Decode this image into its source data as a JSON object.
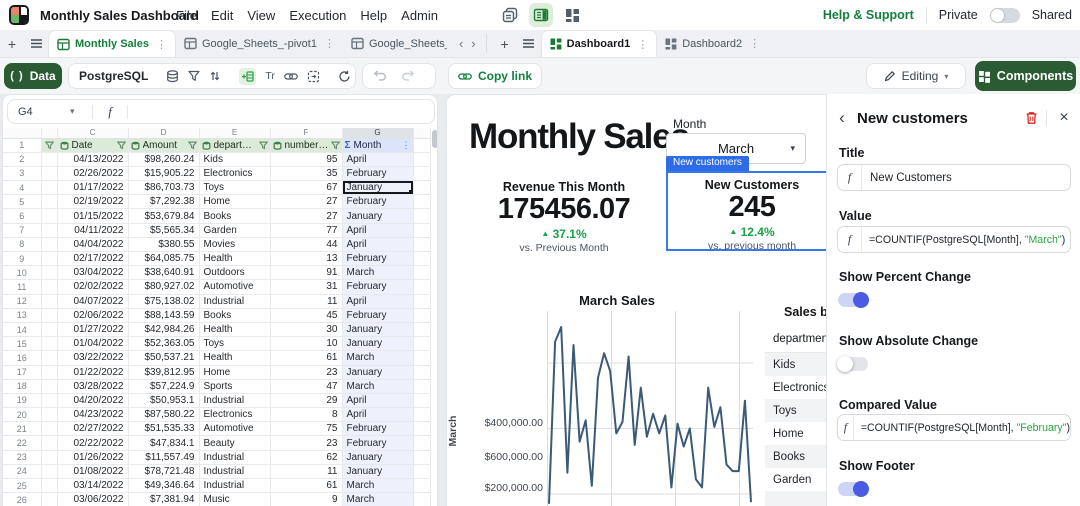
{
  "topbar": {
    "title": "Monthly Sales Dashboard",
    "menus": [
      "File",
      "Edit",
      "View",
      "Execution",
      "Help",
      "Admin"
    ],
    "help_link": "Help & Support",
    "private_label": "Private",
    "shared_label": "Shared"
  },
  "tabs": {
    "sheets": [
      {
        "label": "Monthly Sales",
        "active": true,
        "kebab": true
      },
      {
        "label": "Google_Sheets_-pivot1",
        "active": false,
        "kebab": true
      },
      {
        "label": "Google_Sheets_~",
        "active": false,
        "kebab": false,
        "truncated": true
      }
    ],
    "dashboards": [
      {
        "label": "Dashboard1",
        "active": true,
        "kebab": true
      },
      {
        "label": "Dashboard2",
        "active": false,
        "kebab": true
      }
    ]
  },
  "toolbar": {
    "data_label": "Data",
    "source_label": "PostgreSQL",
    "copy_link_label": "Copy link",
    "editing_label": "Editing",
    "components_label": "Components"
  },
  "formula_bar": {
    "cell_ref": "G4"
  },
  "sheet": {
    "col_letters": [
      "C",
      "D",
      "E",
      "F",
      "G"
    ],
    "headers": [
      "Date",
      "Amount",
      "depart…",
      "number…",
      "Month"
    ],
    "selected": {
      "row": 4,
      "col": "G"
    },
    "rows": [
      [
        "04/13/2022",
        "$98,260.24",
        "Kids",
        "95",
        "April"
      ],
      [
        "02/26/2022",
        "$15,905.22",
        "Electronics",
        "35",
        "February"
      ],
      [
        "01/17/2022",
        "$86,703.73",
        "Toys",
        "67",
        "January"
      ],
      [
        "02/19/2022",
        "$7,292.38",
        "Home",
        "27",
        "February"
      ],
      [
        "01/15/2022",
        "$53,679.84",
        "Books",
        "27",
        "January"
      ],
      [
        "04/11/2022",
        "$5,565.34",
        "Garden",
        "77",
        "April"
      ],
      [
        "04/04/2022",
        "$380.55",
        "Movies",
        "44",
        "April"
      ],
      [
        "02/17/2022",
        "$64,085.75",
        "Health",
        "13",
        "February"
      ],
      [
        "03/04/2022",
        "$38,640.91",
        "Outdoors",
        "91",
        "March"
      ],
      [
        "02/02/2022",
        "$80,927.02",
        "Automotive",
        "31",
        "February"
      ],
      [
        "04/07/2022",
        "$75,138.02",
        "Industrial",
        "11",
        "April"
      ],
      [
        "02/06/2022",
        "$88,143.59",
        "Books",
        "45",
        "February"
      ],
      [
        "01/27/2022",
        "$42,984.26",
        "Health",
        "30",
        "January"
      ],
      [
        "01/04/2022",
        "$52,363.05",
        "Toys",
        "10",
        "January"
      ],
      [
        "03/22/2022",
        "$50,537.21",
        "Health",
        "61",
        "March"
      ],
      [
        "01/22/2022",
        "$39,812.95",
        "Home",
        "23",
        "January"
      ],
      [
        "03/28/2022",
        "$57,224.9",
        "Sports",
        "47",
        "March"
      ],
      [
        "04/20/2022",
        "$50,953.1",
        "Industrial",
        "29",
        "April"
      ],
      [
        "04/23/2022",
        "$87,580.22",
        "Electronics",
        "8",
        "April"
      ],
      [
        "02/27/2022",
        "$51,535.33",
        "Automotive",
        "75",
        "February"
      ],
      [
        "02/22/2022",
        "$47,834.1",
        "Beauty",
        "23",
        "February"
      ],
      [
        "01/26/2022",
        "$11,557.49",
        "Industrial",
        "62",
        "January"
      ],
      [
        "01/08/2022",
        "$78,721.48",
        "Industrial",
        "11",
        "January"
      ],
      [
        "03/14/2022",
        "$49,346.64",
        "Industrial",
        "61",
        "March"
      ],
      [
        "03/06/2022",
        "$7,381.94",
        "Music",
        "9",
        "March"
      ]
    ]
  },
  "dashboard": {
    "title": "Monthly Sales",
    "filter_label": "Month",
    "filter_value": "March",
    "kpi_revenue": {
      "title": "Revenue This Month",
      "value": "175456.07",
      "change": "37.1%",
      "footer": "vs. Previous Month"
    },
    "kpi_customers": {
      "tag": "New customers",
      "title": "New Customers",
      "value": "245",
      "change": "12.4%",
      "footer": "vs. previous month"
    },
    "dept_table": {
      "title": "Sales by",
      "column": "department",
      "rows": [
        "Kids",
        "Electronics",
        "Toys",
        "Home",
        "Books",
        "Garden"
      ]
    }
  },
  "chart_data": {
    "type": "line",
    "title": "March Sales",
    "ylabel": "March",
    "xlabel": "",
    "y_ticks": [
      "$200,000.00",
      "$400,000.00",
      "$600,000.00"
    ],
    "ylim": [
      164000,
      753000
    ],
    "grid": true,
    "line_color": "#3a5a78",
    "values": [
      170000,
      665000,
      710000,
      265000,
      655000,
      360000,
      425000,
      225000,
      555000,
      630000,
      575000,
      385000,
      420000,
      620000,
      350000,
      525000,
      375000,
      445000,
      385000,
      440000,
      220000,
      415000,
      345000,
      400000,
      245000,
      220000,
      525000,
      405000,
      465000,
      290000,
      270000,
      270000,
      485000,
      175000
    ]
  },
  "panel": {
    "title": "New customers",
    "title_field": {
      "label": "Title",
      "value": "New Customers"
    },
    "value_field": {
      "label": "Value",
      "prefix": "=COUNTIF(PostgreSQL[Month], ",
      "string": "\"March\"",
      "suffix": ")"
    },
    "compared_field": {
      "label": "Compared Value",
      "prefix": "=COUNTIF(PostgreSQL[Month], ",
      "string": "\"February\"",
      "suffix": ")"
    },
    "toggles": [
      {
        "label": "Show Percent Change",
        "on": true
      },
      {
        "label": "Show Absolute Change",
        "on": false
      },
      {
        "label": "Show Footer",
        "on": true
      }
    ]
  },
  "colors": {
    "brand_dark_green": "#2b5b33",
    "link_green": "#15803d",
    "selection_blue": "#2e6be6",
    "toggle_blue": "#4b5ce4",
    "formula_string_green": "#2f9e44",
    "kpi_change_green": "#17a34a",
    "chart_line": "#3a5a78",
    "header_green_bg": "#dcead9",
    "month_col_bg": "#edf1fb"
  }
}
